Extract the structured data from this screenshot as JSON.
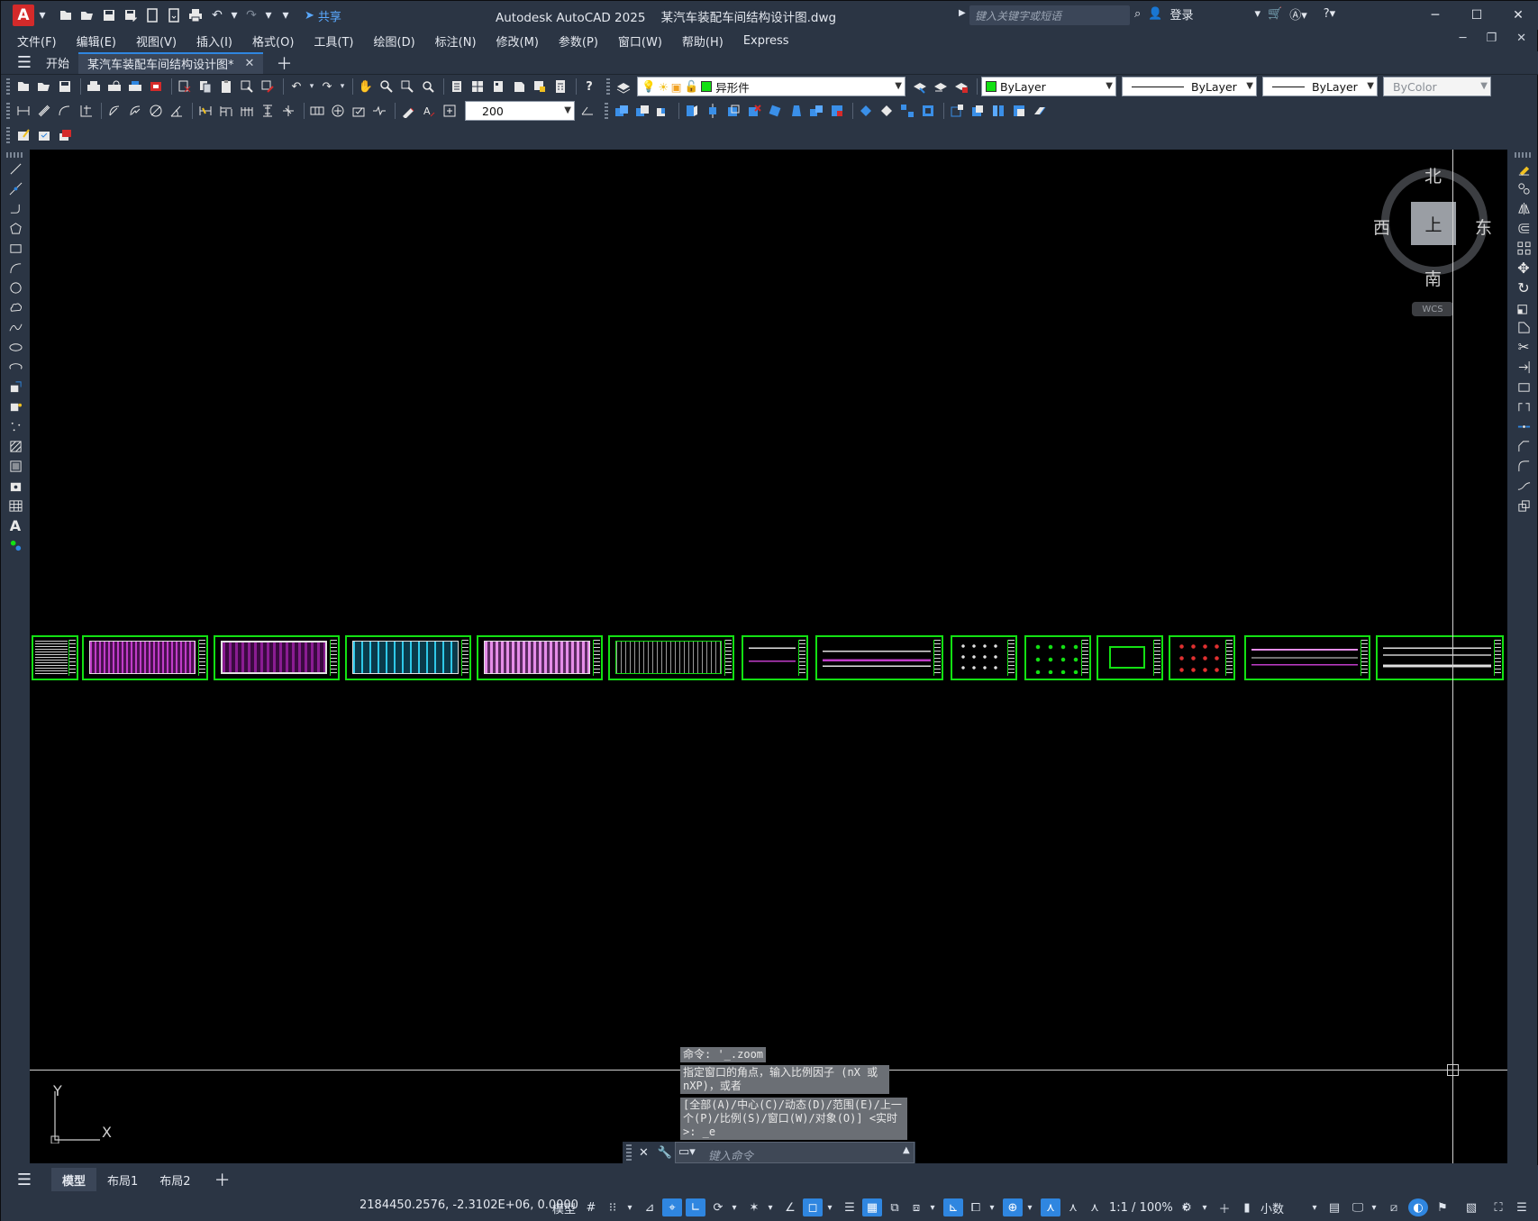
{
  "app": {
    "logo": "A",
    "title": "Autodesk AutoCAD 2025",
    "file": "某汽车装配车间结构设计图.dwg",
    "share": "共享",
    "search_placeholder": "键入关键字或短语",
    "login": "登录"
  },
  "menu": [
    "文件(F)",
    "编辑(E)",
    "视图(V)",
    "插入(I)",
    "格式(O)",
    "工具(T)",
    "绘图(D)",
    "标注(N)",
    "修改(M)",
    "参数(P)",
    "窗口(W)",
    "帮助(H)",
    "Express"
  ],
  "tabs": {
    "start": "开始",
    "active": "某汽车装配车间结构设计图*"
  },
  "toolbar": {
    "layer": "异形件",
    "color": "ByLayer",
    "linetype": "ByLayer",
    "lineweight": "ByLayer",
    "plotstyle": "ByColor",
    "dimscale": "200"
  },
  "viewcube": {
    "north": "北",
    "south": "南",
    "west": "西",
    "east": "东",
    "face": "上",
    "wcs": "WCS"
  },
  "ucs": {
    "x": "X",
    "y": "Y"
  },
  "command": {
    "history": [
      "命令: '_.zoom",
      "指定窗口的角点，输入比例因子 (nX 或 nXP)，或者",
      "[全部(A)/中心(C)/动态(D)/范围(E)/上一个(P)/比例(S)/窗口(W)/对象(O)] <实时>: _e"
    ],
    "placeholder": "键入命令"
  },
  "layouts": [
    "模型",
    "布局1",
    "布局2"
  ],
  "status": {
    "coords": "2184450.2576, -2.3102E+06, 0.0000",
    "model": "模型",
    "scale": "1:1 / 100%",
    "units": "小数"
  },
  "colors": {
    "accent": "#2f86e0",
    "sheet_border": "#13e013",
    "magenta": "#c03cc8",
    "cyan": "#2fc8e8",
    "pink": "#e58de8"
  }
}
